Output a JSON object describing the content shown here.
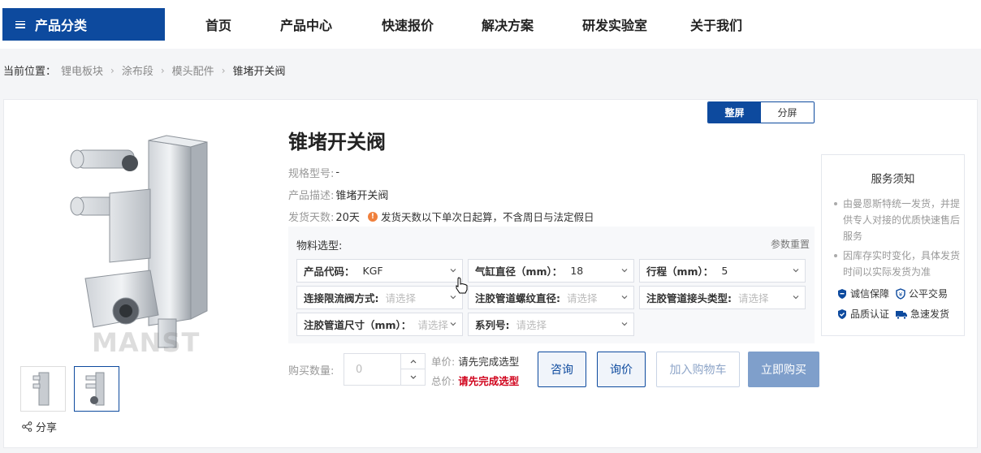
{
  "header": {
    "category_label": "产品分类",
    "nav": [
      "首页",
      "产品中心",
      "快速报价",
      "解决方案",
      "研发实验室",
      "关于我们"
    ]
  },
  "breadcrumb": {
    "label": "当前位置：",
    "items": [
      "锂电板块",
      "涂布段",
      "模头配件"
    ],
    "current": "锥堵开关阀"
  },
  "view_toggle": {
    "full": "整屏",
    "split": "分屏"
  },
  "product": {
    "title": "锥堵开关阀",
    "watermark": "MANST",
    "spec_label": "规格型号:",
    "spec_value": "-",
    "desc_label": "产品描述:",
    "desc_value": "锥堵开关阀",
    "ship_label": "发货天数:",
    "ship_value": "20天",
    "ship_note": "发货天数以下单次日起算，不含周日与法定假日",
    "share_label": "分享"
  },
  "selection": {
    "title": "物料选型:",
    "reset": "参数重置",
    "fields": [
      {
        "label": "产品代码：",
        "value": "KGF"
      },
      {
        "label": "气缸直径（mm）：",
        "value": "18"
      },
      {
        "label": "行程（mm）：",
        "value": "5"
      },
      {
        "label": "连接限流阀方式:",
        "placeholder": "请选择"
      },
      {
        "label": "注胶管道螺纹直径:",
        "placeholder": "请选择"
      },
      {
        "label": "注胶管道接头类型:",
        "placeholder": "请选择"
      },
      {
        "label": "注胶管道尺寸（mm）：",
        "placeholder": "请选择"
      },
      {
        "label": "系列号:",
        "placeholder": "请选择"
      }
    ]
  },
  "purchase": {
    "qty_label": "购买数量:",
    "qty_value": "0",
    "unit_price_label": "单价:",
    "unit_price_value": "请先完成选型",
    "total_price_label": "总价:",
    "total_price_value": "请先完成选型",
    "btn_consult": "咨询",
    "btn_inquiry": "询价",
    "btn_cart": "加入购物车",
    "btn_buy": "立即购买"
  },
  "service": {
    "title": "服务须知",
    "notes": [
      "由曼恩斯特统一发货，并提供专人对接的优质快速售后服务",
      "因库存实时变化，具体发货时间以实际发货为准"
    ],
    "badges": [
      "诚信保障",
      "公平交易",
      "品质认证",
      "急速发货"
    ]
  },
  "colors": {
    "brand": "#0d4a9e",
    "price_red": "#d0021b",
    "warn": "#f0803c"
  }
}
